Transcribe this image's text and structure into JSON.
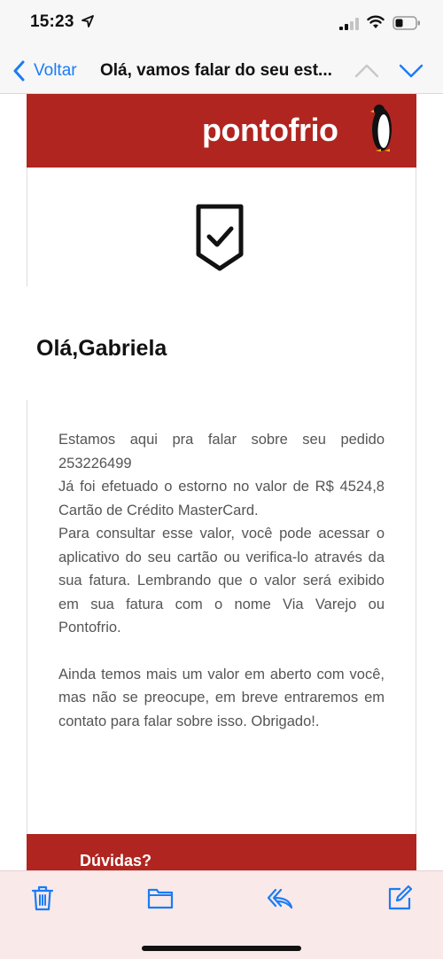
{
  "status_bar": {
    "time": "15:23",
    "icons": [
      "location-arrow-icon",
      "signal-icon",
      "wifi-icon",
      "battery-icon"
    ]
  },
  "nav": {
    "back_label": "Voltar",
    "title": "Olá, vamos falar do seu est...",
    "icons": [
      "chevron-left-icon",
      "chevron-up-icon",
      "chevron-down-icon"
    ],
    "accent_color": "#1a7cf5"
  },
  "email": {
    "brand": "pontofrio",
    "brand_color": "#b02520",
    "greeting": "Olá,Gabriela",
    "paragraph_lines": [
      "Estamos aqui pra falar sobre seu pedido 253226499",
      "Já foi efetuado o estorno no valor de R$ 4524,8 Cartão de Crédito MasterCard.",
      "Para consultar esse valor, você pode acessar o aplicativo do seu cartão ou verifica-lo através da sua fatura. Lembrando que o valor será exibido em sua fatura com o nome Via Varejo ou Pontofrio."
    ],
    "paragraph2": "Ainda temos mais um valor em aberto com você, mas não se preocupe, em breve entraremos em contato para falar sobre isso. Obrigado!.",
    "footer_heading": "Dúvidas?"
  },
  "toolbar": {
    "icons": [
      "trash-icon",
      "folder-icon",
      "reply-icon",
      "compose-icon"
    ]
  }
}
